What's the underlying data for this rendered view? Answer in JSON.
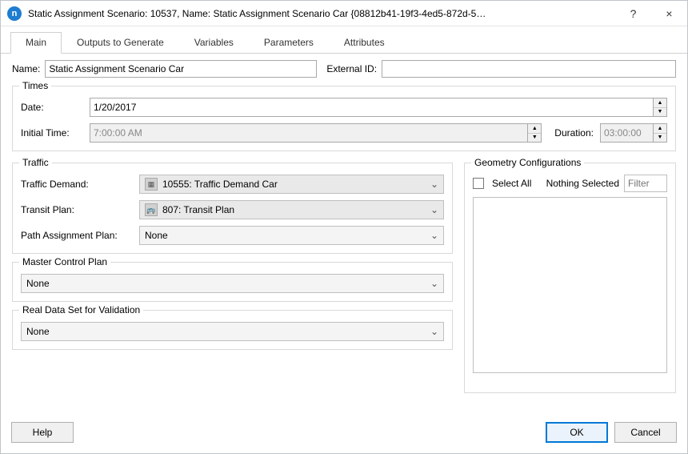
{
  "window": {
    "title": "Static Assignment Scenario: 10537, Name: Static Assignment Scenario Car  {08812b41-19f3-4ed5-872d-5…",
    "help_tooltip": "?",
    "close_tooltip": "×"
  },
  "tabs": [
    {
      "label": "Main",
      "active": true
    },
    {
      "label": "Outputs to Generate",
      "active": false
    },
    {
      "label": "Variables",
      "active": false
    },
    {
      "label": "Parameters",
      "active": false
    },
    {
      "label": "Attributes",
      "active": false
    }
  ],
  "main": {
    "name_label": "Name:",
    "name_value": "Static Assignment Scenario Car",
    "external_id_label": "External ID:",
    "external_id_value": ""
  },
  "times": {
    "group_title": "Times",
    "date_label": "Date:",
    "date_value": "1/20/2017",
    "initial_time_label": "Initial Time:",
    "initial_time_value": "7:00:00 AM",
    "duration_label": "Duration:",
    "duration_value": "03:00:00"
  },
  "traffic": {
    "group_title": "Traffic",
    "demand_label": "Traffic Demand:",
    "demand_value": "10555: Traffic Demand Car",
    "transit_label": "Transit Plan:",
    "transit_value": "807: Transit Plan",
    "path_label": "Path Assignment Plan:",
    "path_value": "None"
  },
  "master_control": {
    "group_title": "Master Control Plan",
    "value": "None"
  },
  "real_data": {
    "group_title": "Real Data Set for Validation",
    "value": "None"
  },
  "geometry": {
    "group_title": "Geometry Configurations",
    "select_all_label": "Select All",
    "status_text": "Nothing Selected",
    "filter_placeholder": "Filter"
  },
  "footer": {
    "help_label": "Help",
    "ok_label": "OK",
    "cancel_label": "Cancel"
  }
}
